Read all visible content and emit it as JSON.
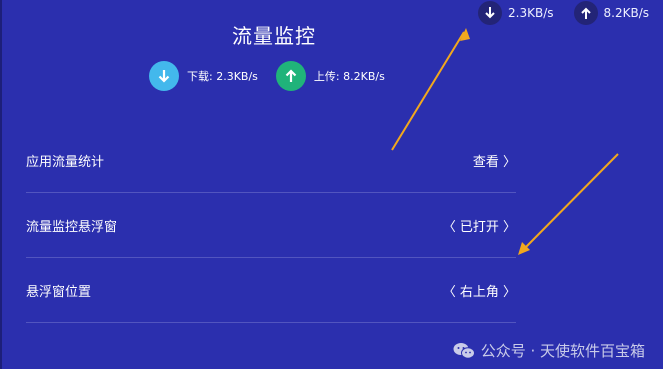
{
  "header": {
    "title": "流量监控"
  },
  "status_bar": {
    "download_speed": "2.3KB/s",
    "upload_speed": "8.2KB/s"
  },
  "speeds": {
    "download_label": "下载: 2.3KB/s",
    "upload_label": "上传: 8.2KB/s"
  },
  "settings": {
    "app_stats": {
      "label": "应用流量统计",
      "value": "查看 〉"
    },
    "floating_window": {
      "label": "流量监控悬浮窗",
      "value": "〈 已打开 〉"
    },
    "window_position": {
      "label": "悬浮窗位置",
      "value": "〈 右上角 〉"
    }
  },
  "watermark": {
    "text": "公众号 · 天使软件百宝箱"
  },
  "colors": {
    "background": "#2b2fae",
    "download_circle": "#43b8ec",
    "upload_circle": "#20b37a",
    "annotation_arrow": "#f2a81d"
  },
  "icons": [
    "download-arrow-icon",
    "upload-arrow-icon",
    "wechat-icon"
  ]
}
